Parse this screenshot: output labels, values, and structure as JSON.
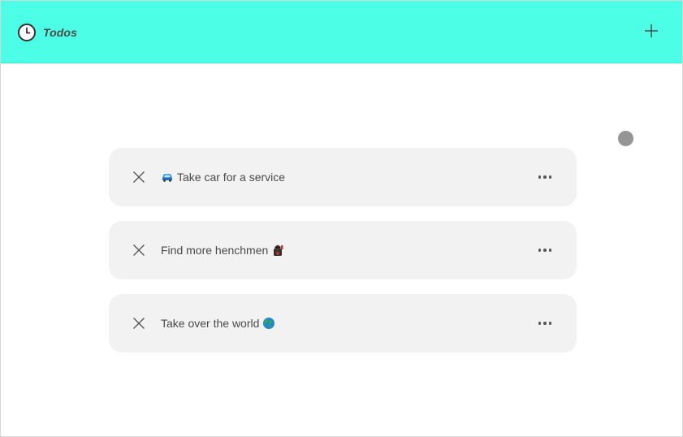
{
  "header": {
    "title": "Todos",
    "icon": "clock-icon",
    "add_icon": "plus-icon",
    "background": "#4cfee5"
  },
  "todos": [
    {
      "text": "Take car for a service",
      "emoji": "car-icon",
      "emoji_position": "before"
    },
    {
      "text": "Find more henchmen",
      "emoji": "henchman-icon",
      "emoji_position": "after"
    },
    {
      "text": "Take over the world",
      "emoji": "globe-icon",
      "emoji_position": "after"
    }
  ],
  "colors": {
    "card": "#f2f2f2",
    "text": "#4a4a4a",
    "status_dot": "#959595"
  }
}
